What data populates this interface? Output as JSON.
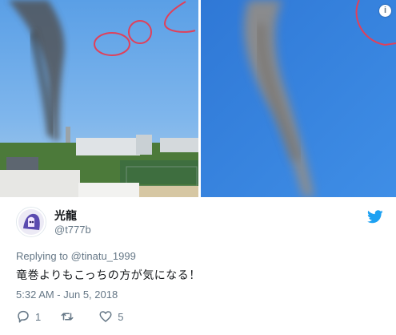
{
  "media": {
    "photos": [
      "left-photo",
      "right-photo"
    ],
    "info_icon": "info-icon",
    "info_glyph": "i"
  },
  "author": {
    "display_name": "光龍",
    "handle": "@t777b",
    "avatar_icon": "avatar"
  },
  "tweet": {
    "replying_prefix": "Replying to",
    "replying_to": "@tinatu_1999",
    "text": "竜巻よりもこっちの方が気になる！",
    "timestamp": "5:32 AM - Jun 5, 2018"
  },
  "actions": {
    "reply_count": "1",
    "retweet_count": "",
    "like_count": "5"
  },
  "colors": {
    "text": "#14171a",
    "secondary": "#657786",
    "twitter_blue": "#1da1f2"
  }
}
